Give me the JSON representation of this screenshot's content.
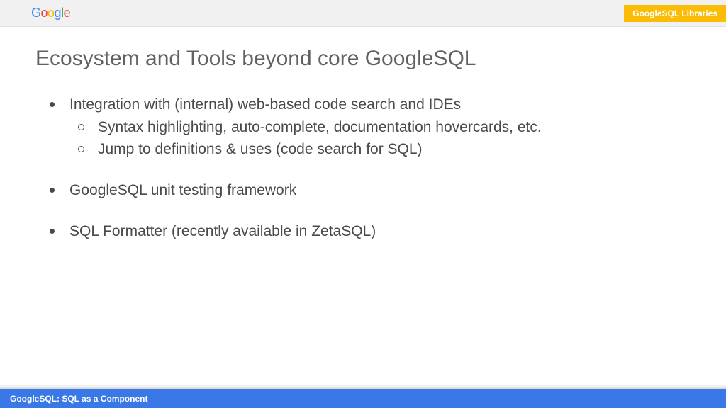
{
  "header": {
    "badge": "GoogleSQL Libraries"
  },
  "slide": {
    "title": "Ecosystem and Tools beyond core GoogleSQL",
    "bullets": [
      {
        "text": "Integration with (internal) web-based code search and IDEs",
        "sub": [
          "Syntax highlighting, auto-complete, documentation hovercards, etc.",
          "Jump to definitions & uses (code search for SQL)"
        ]
      },
      {
        "text": "GoogleSQL unit testing framework",
        "sub": []
      },
      {
        "text": "SQL Formatter (recently available in ZetaSQL)",
        "sub": []
      }
    ]
  },
  "footer": {
    "text": "GoogleSQL: SQL as a Component"
  }
}
